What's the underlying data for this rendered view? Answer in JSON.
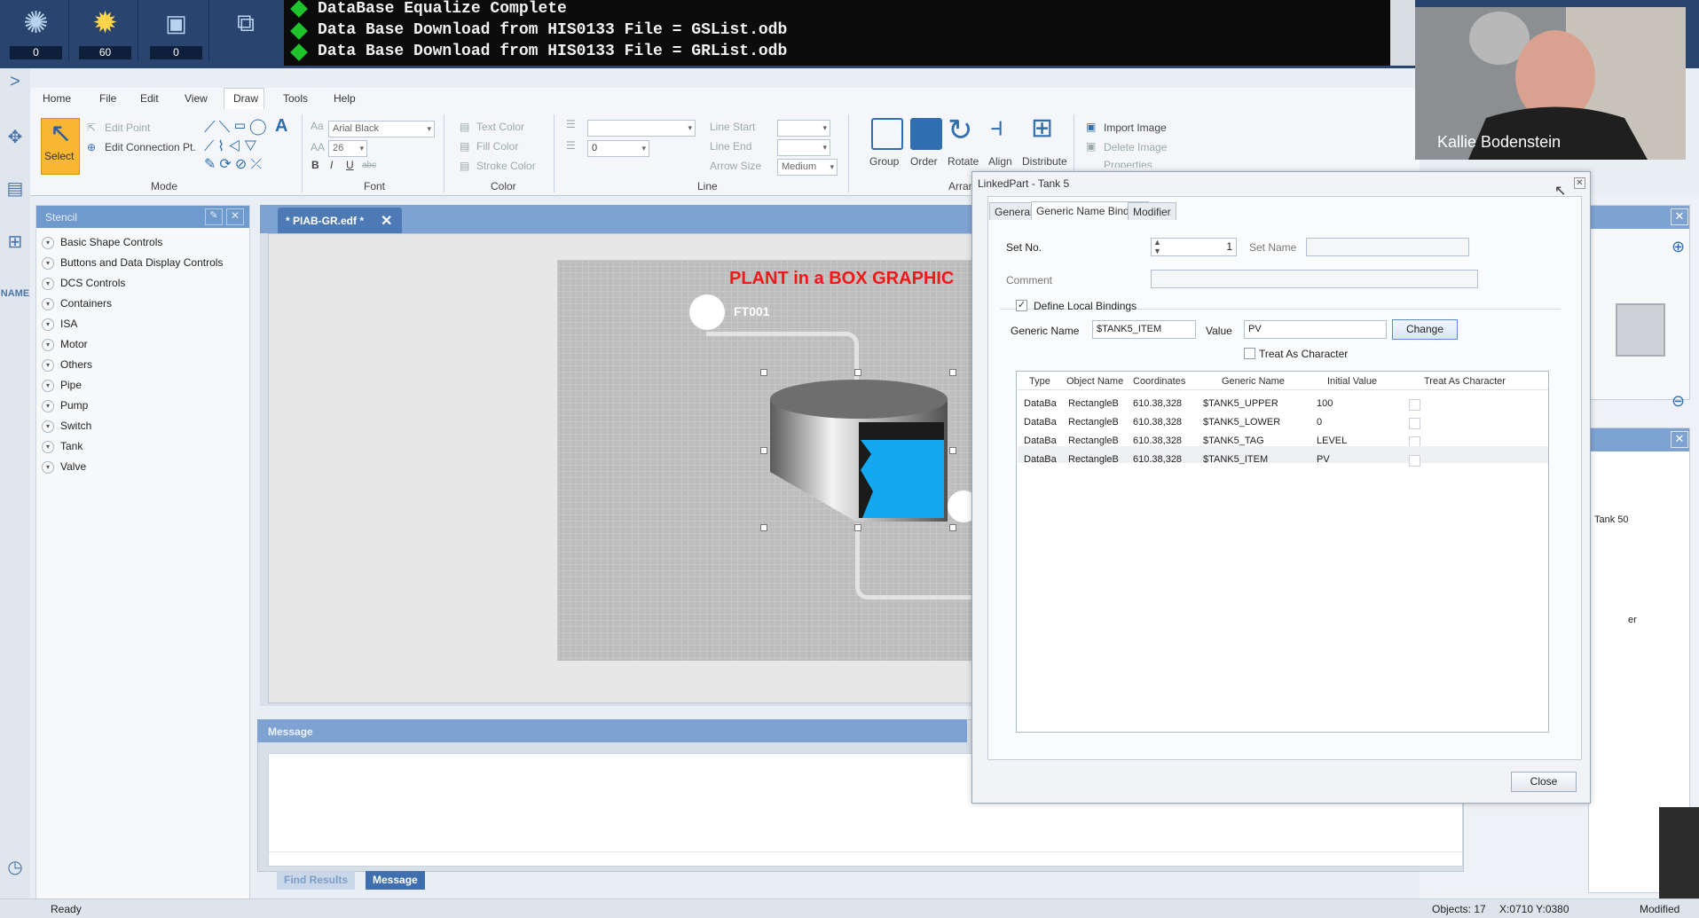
{
  "topbar": {
    "counters": [
      {
        "icon": "sun-alarm-icon",
        "count": "0"
      },
      {
        "icon": "sun-active-icon",
        "count": "60"
      },
      {
        "icon": "operator-icon",
        "count": "0"
      }
    ],
    "messages": [
      "DataBase Equalize Complete",
      "Data Base Download from HIS0133 File = GSList.odb",
      "Data Base Download from HIS0133 File = GRList.odb"
    ]
  },
  "nav": {
    "name_label": "NAME"
  },
  "menu": {
    "items": [
      "Home",
      "File",
      "Edit",
      "View",
      "Draw",
      "Tools",
      "Help"
    ],
    "active": "Draw"
  },
  "ribbon": {
    "mode": {
      "select": "Select",
      "edit_point": "Edit Point",
      "edit_connection": "Edit Connection Pt.",
      "group": "Mode"
    },
    "font": {
      "family": "Arial Black",
      "size": "26",
      "group": "Font",
      "bold": "B",
      "italic": "I",
      "underline": "U",
      "strike": "abc"
    },
    "color": {
      "text_color": "Text Color",
      "fill_color": "Fill Color",
      "stroke_color": "Stroke Color",
      "group": "Color"
    },
    "line": {
      "width_value": "0",
      "line_start": "Line Start",
      "line_end": "Line End",
      "arrow_size": "Arrow Size",
      "arrow_size_value": "Medium",
      "group": "Line"
    },
    "arrange": {
      "group_btn": "Group",
      "order": "Order",
      "rotate": "Rotate",
      "align": "Align",
      "distribute": "Distribute",
      "group": "Arran"
    },
    "image": {
      "import": "Import Image",
      "delete": "Delete Image",
      "properties": "Properties"
    }
  },
  "stencil": {
    "title": "Stencil",
    "items": [
      "Basic Shape Controls",
      "Buttons and Data Display Controls",
      "DCS Controls",
      "Containers",
      "ISA",
      "Motor",
      "Others",
      "Pipe",
      "Pump",
      "Switch",
      "Tank",
      "Valve"
    ]
  },
  "editor": {
    "tab": "* PIAB-GR.edf *",
    "canvas_title": "PLANT in a BOX GRAPHIC",
    "tag": "FT001"
  },
  "message_panel": {
    "title": "Message",
    "tabs": [
      "Find Results",
      "Message"
    ]
  },
  "status": {
    "left": "Ready",
    "objects": "Objects: 17",
    "coords": "X:0710  Y:0380",
    "state": "Modified"
  },
  "right": {
    "tank_label": "Tank 50",
    "er": "er"
  },
  "webcam": {
    "name": "Kallie Bodenstein"
  },
  "dialog": {
    "title": "LinkedPart - Tank 5",
    "tabs": [
      "General",
      "Generic Name Binding",
      "Modifier"
    ],
    "set_no_label": "Set No.",
    "set_no_value": "1",
    "set_name_label": "Set Name",
    "comment_label": "Comment",
    "define_local": "Define Local Bindings",
    "generic_name_label": "Generic Name",
    "generic_name_value": "$TANK5_ITEM",
    "value_label": "Value",
    "value_value": "PV",
    "change_btn": "Change",
    "treat_as_char": "Treat As Character",
    "columns": [
      "Type",
      "Object Name",
      "Coordinates",
      "Generic Name",
      "Initial Value",
      "Treat As Character"
    ],
    "rows": [
      {
        "type": "DataBa",
        "object": "RectangleB",
        "coords": "610.38,328",
        "generic": "$TANK5_UPPER",
        "initial": "100"
      },
      {
        "type": "DataBa",
        "object": "RectangleB",
        "coords": "610.38,328",
        "generic": "$TANK5_LOWER",
        "initial": "0"
      },
      {
        "type": "DataBa",
        "object": "RectangleB",
        "coords": "610.38,328",
        "generic": "$TANK5_TAG",
        "initial": "LEVEL"
      },
      {
        "type": "DataBa",
        "object": "RectangleB",
        "coords": "610.38,328",
        "generic": "$TANK5_ITEM",
        "initial": "PV"
      }
    ],
    "close_btn": "Close"
  }
}
